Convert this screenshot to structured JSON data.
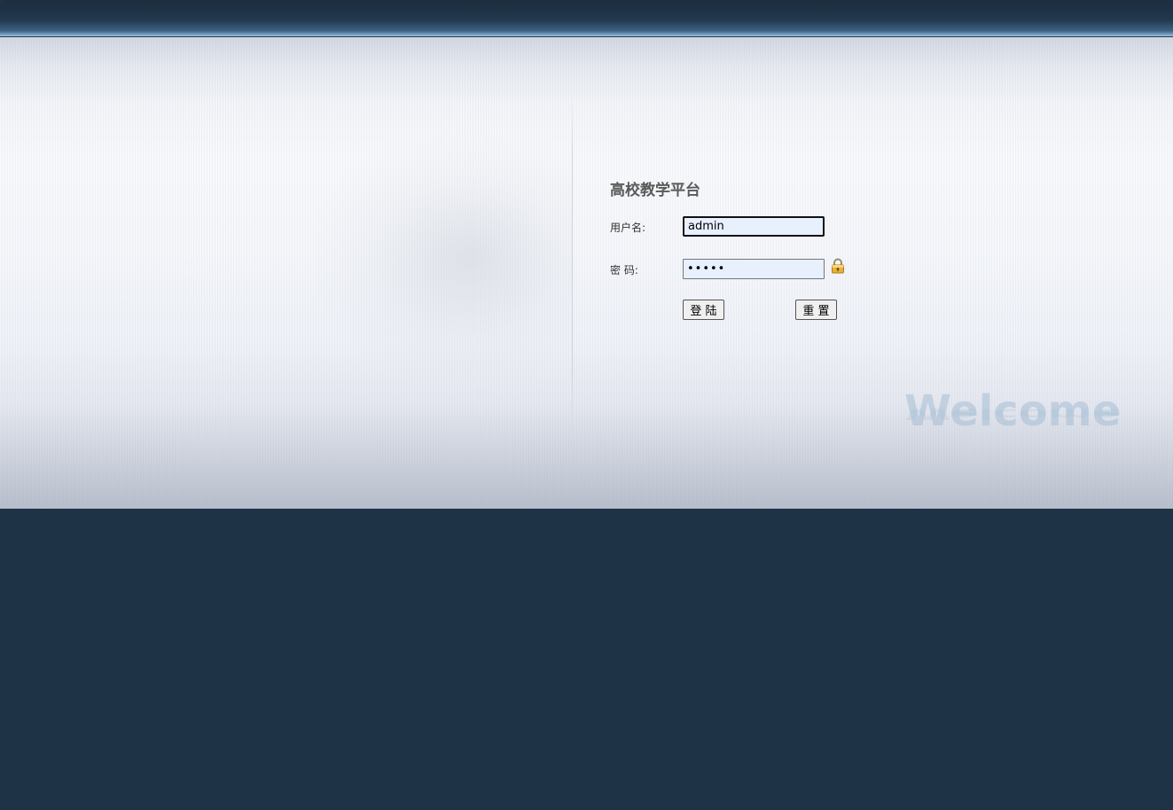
{
  "app": {
    "title": "高校教学平台"
  },
  "form": {
    "username_label": "用户名:",
    "username_value": "admin",
    "password_label": "密 码:",
    "password_value": "•••••",
    "login_label": "登 陆",
    "reset_label": "重 置"
  },
  "decor": {
    "welcome_text": "Welcome",
    "lock_icon": "padlock-icon"
  },
  "colors": {
    "background_dark": "#1f3347",
    "title_text": "#5a5a5a",
    "input_fill": "#e8f0fe",
    "welcome_watermark": "#a5bed4"
  }
}
